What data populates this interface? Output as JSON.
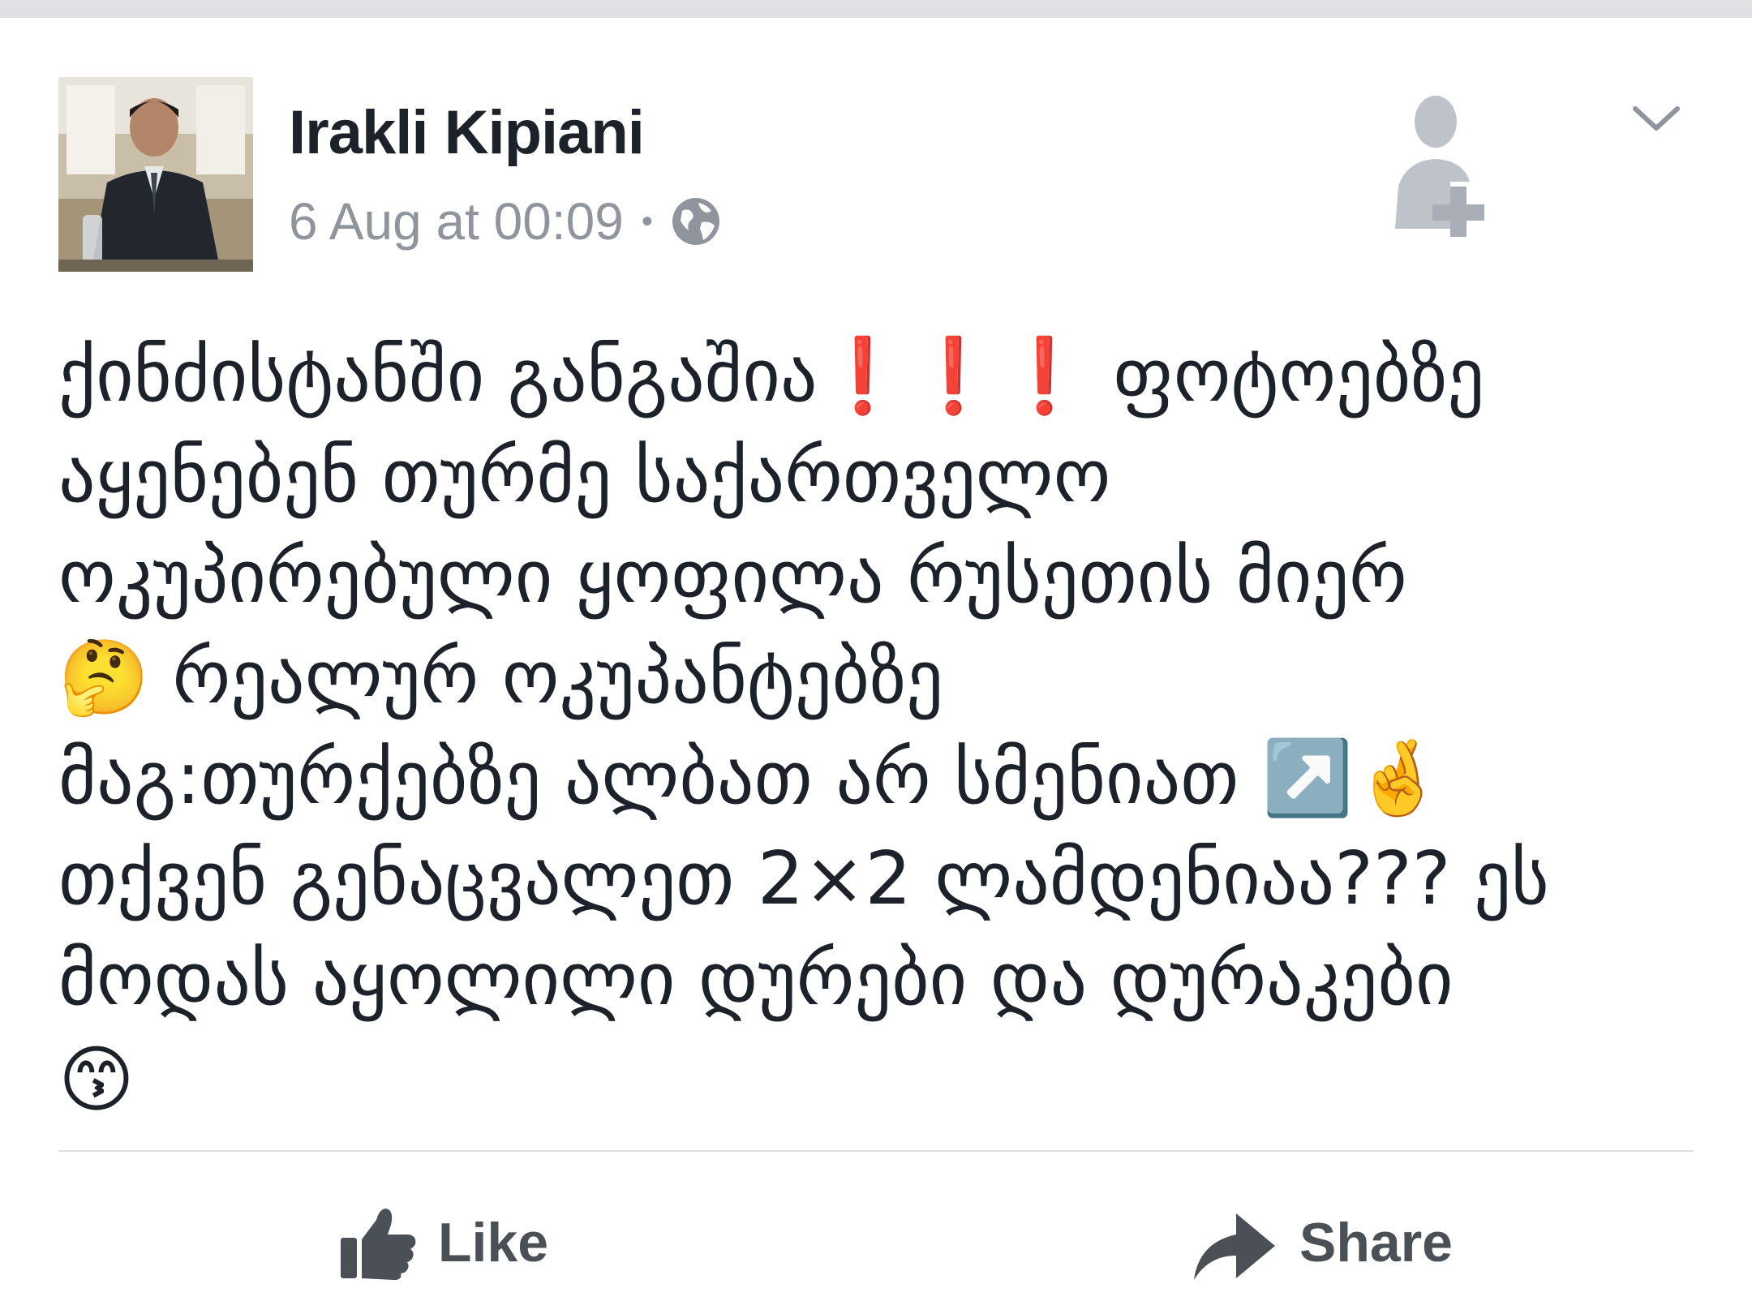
{
  "post": {
    "author": "Irakli Kipiani",
    "timestamp": "6 Aug at 00:09",
    "separator": "•",
    "privacy_icon": "globe-icon",
    "header_icons": [
      "add-friend-icon",
      "chevron-down-icon"
    ],
    "message_lines": [
      "ქინძისტანში განგაშია❗❗❗ ფოტოებზე",
      "აყენებენ თურმე საქართველო",
      "ოკუპირებული ყოფილა რუსეთის მიერ",
      "🤔 რეალურ ოკუპანტებზე",
      "მაგ:თურქებზე ალბათ არ სმენიათ ↗️🤞",
      "თქვენ გენაცვალეთ 2×2 ლამდენიაა??? ეს",
      "მოდას აყოლილი დურები და დურაკები",
      "😙"
    ]
  },
  "actions": {
    "like_label": "Like",
    "share_label": "Share"
  },
  "colors": {
    "text": "#1d2129",
    "meta": "#90949c",
    "icon_gray": "#bec2c9",
    "action_gray": "#4b4f56",
    "divider": "#dadde1"
  }
}
